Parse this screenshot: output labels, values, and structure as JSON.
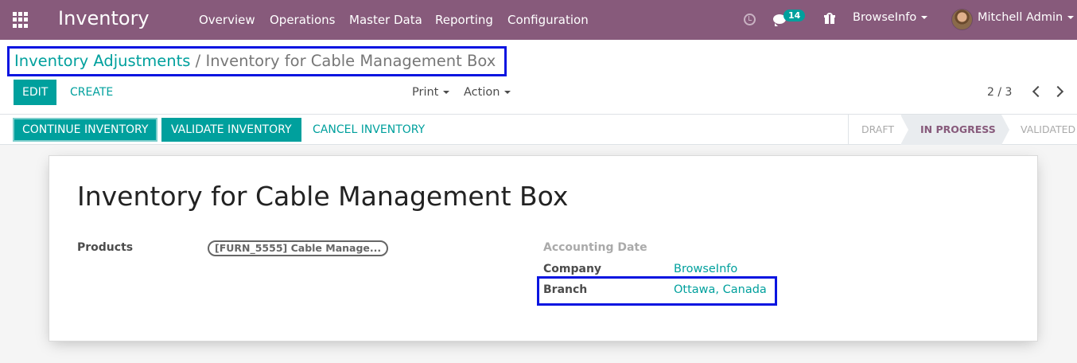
{
  "navbar": {
    "app_title": "Inventory",
    "menu": [
      "Overview",
      "Operations",
      "Master Data",
      "Reporting",
      "Configuration"
    ],
    "messages_count": "14",
    "company": "BrowseInfo",
    "user": "Mitchell Admin"
  },
  "breadcrumb": {
    "parent": "Inventory Adjustments",
    "separator": "/",
    "current": "Inventory for Cable Management Box"
  },
  "buttons": {
    "edit": "EDIT",
    "create": "CREATE",
    "print": "Print",
    "action": "Action"
  },
  "pager": {
    "value": "2 / 3"
  },
  "statusbar": {
    "continue": "CONTINUE INVENTORY",
    "validate": "VALIDATE INVENTORY",
    "cancel": "CANCEL INVENTORY",
    "states": [
      "DRAFT",
      "IN PROGRESS",
      "VALIDATED"
    ],
    "active_state": "IN PROGRESS"
  },
  "form": {
    "title": "Inventory for Cable Management Box",
    "products_label": "Products",
    "product_tag": "[FURN_5555] Cable Manage...",
    "accounting_date_label": "Accounting Date",
    "company_label": "Company",
    "company_value": "BrowseInfo",
    "branch_label": "Branch",
    "branch_value": "Ottawa, Canada"
  },
  "colors": {
    "brand": "#875a7b",
    "primary": "#00a09d",
    "highlight_box": "#0a15e0"
  }
}
